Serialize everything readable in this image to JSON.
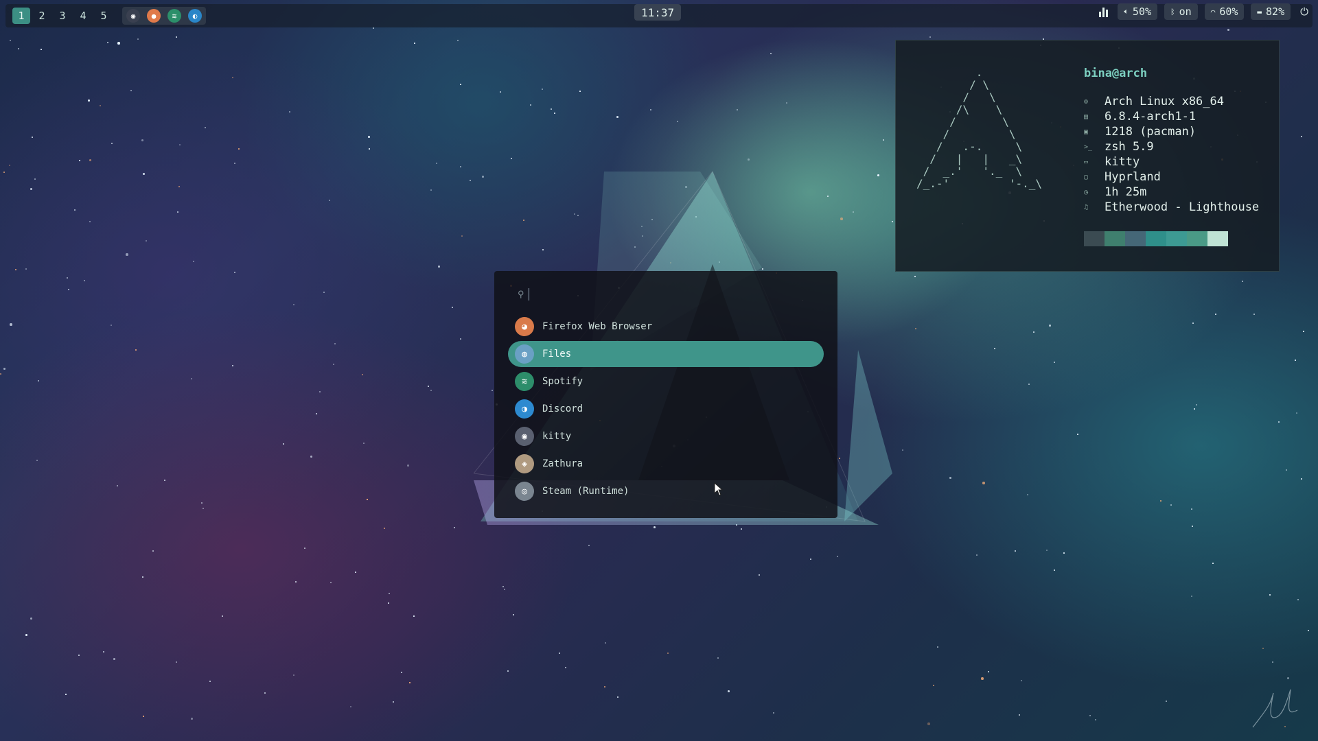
{
  "workspaces": [
    {
      "label": "1",
      "active": true
    },
    {
      "label": "2",
      "active": false
    },
    {
      "label": "3",
      "active": false
    },
    {
      "label": "4",
      "active": false
    },
    {
      "label": "5",
      "active": false
    }
  ],
  "tray_apps": [
    {
      "name": "kitty",
      "icon": "kitty-icon",
      "color": "#3a4050"
    },
    {
      "name": "firefox",
      "icon": "firefox-icon",
      "color": "#e07a4a"
    },
    {
      "name": "spotify",
      "icon": "spotify-icon",
      "color": "#2c8f6a"
    },
    {
      "name": "discord",
      "icon": "discord-icon",
      "color": "#2a86c8"
    }
  ],
  "clock": "11:37",
  "status": {
    "volume": "50%",
    "bluetooth": "on",
    "wifi": "60%",
    "battery": "82%"
  },
  "fetch": {
    "userhost": "bina@arch",
    "ascii": [
      "         .",
      "        / \\",
      "       /   \\",
      "      /\\    \\",
      "     /       \\",
      "    /         \\",
      "   /   .-.     \\",
      "  /   |   |   _\\",
      " /  _.'   '._  \\",
      "/_.-'         '-._\\"
    ],
    "rows": [
      {
        "icon": "gear-icon",
        "glyph": "⚙",
        "value": "Arch Linux x86_64"
      },
      {
        "icon": "chip-icon",
        "glyph": "▤",
        "value": "6.8.4-arch1-1"
      },
      {
        "icon": "package-icon",
        "glyph": "▣",
        "value": "1218 (pacman)"
      },
      {
        "icon": "shell-icon",
        "glyph": ">_",
        "value": "zsh 5.9"
      },
      {
        "icon": "terminal-icon",
        "glyph": "▭",
        "value": "kitty"
      },
      {
        "icon": "window-icon",
        "glyph": "▢",
        "value": "Hyprland"
      },
      {
        "icon": "clock-icon",
        "glyph": "◷",
        "value": "1h 25m"
      },
      {
        "icon": "music-icon",
        "glyph": "♫",
        "value": "Etherwood - Lighthouse"
      }
    ],
    "palette": [
      "#3b4b52",
      "#3f7f6e",
      "#456777",
      "#2f8f8a",
      "#3d9a93",
      "#4a9a86",
      "#bfe2d4"
    ]
  },
  "launcher": {
    "search_placeholder": "",
    "apps": [
      {
        "label": "Firefox Web Browser",
        "icon": "firefox-icon",
        "color": "#d97a4a",
        "selected": false
      },
      {
        "label": "Files",
        "icon": "files-icon",
        "color": "#6aa0c4",
        "selected": true
      },
      {
        "label": "Spotify",
        "icon": "spotify-icon",
        "color": "#2d8d6a",
        "selected": false
      },
      {
        "label": "Discord",
        "icon": "discord-icon",
        "color": "#2d8ad0",
        "selected": false
      },
      {
        "label": "kitty",
        "icon": "kitty-icon",
        "color": "#5a6070",
        "selected": false
      },
      {
        "label": "Zathura",
        "icon": "zathura-icon",
        "color": "#b09a80",
        "selected": false
      },
      {
        "label": "Steam (Runtime)",
        "icon": "steam-icon",
        "color": "#7a8590",
        "selected": false
      }
    ]
  },
  "colors": {
    "accent": "#3f958a",
    "bar_bg": "#161e2c"
  }
}
